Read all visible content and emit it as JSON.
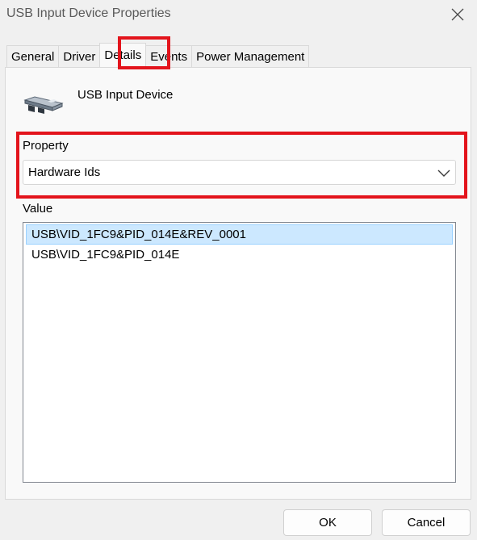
{
  "window": {
    "title": "USB Input Device Properties"
  },
  "tabs": [
    {
      "label": "General",
      "active": false
    },
    {
      "label": "Driver",
      "active": false
    },
    {
      "label": "Details",
      "active": true
    },
    {
      "label": "Events",
      "active": false
    },
    {
      "label": "Power Management",
      "active": false
    }
  ],
  "device": {
    "name": "USB Input Device",
    "icon": "usb-input-device-icon"
  },
  "property": {
    "label": "Property",
    "selected": "Hardware Ids"
  },
  "value": {
    "label": "Value",
    "items": [
      {
        "text": "USB\\VID_1FC9&PID_014E&REV_0001",
        "selected": true
      },
      {
        "text": "USB\\VID_1FC9&PID_014E",
        "selected": false
      }
    ]
  },
  "buttons": {
    "ok": "OK",
    "cancel": "Cancel"
  },
  "colors": {
    "highlight_border": "#e3141c",
    "selection_bg": "#cce8ff",
    "selection_border": "#99d1ff",
    "window_bg": "#f0f0f0",
    "panel_bg": "#f9f9f9"
  }
}
